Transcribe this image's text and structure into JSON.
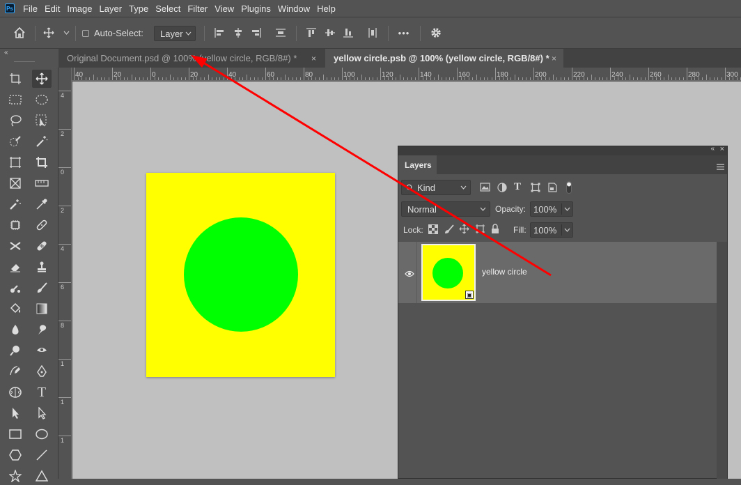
{
  "app": {
    "logo_text": "Ps"
  },
  "menu": [
    "File",
    "Edit",
    "Image",
    "Layer",
    "Type",
    "Select",
    "Filter",
    "View",
    "Plugins",
    "Window",
    "Help"
  ],
  "options": {
    "auto_select_label": "Auto-Select:",
    "layer_select_value": "Layer",
    "more_label": "•••"
  },
  "tabs": [
    {
      "label": "Original Document.psd @ 100% (yellow circle, RGB/8#) *",
      "close": "×"
    },
    {
      "label": "yellow circle.psb @ 100% (yellow circle, RGB/8#) *",
      "close": "×"
    }
  ],
  "ruler_top_labels": [
    "40",
    "20",
    "0",
    "20",
    "40",
    "60",
    "80",
    "100",
    "120",
    "140",
    "160",
    "180",
    "200",
    "220",
    "240",
    "260",
    "280",
    "300"
  ],
  "ruler_left_labels": [
    "4",
    "2",
    "0",
    "2",
    "4",
    "6",
    "8",
    "1",
    "1",
    "1"
  ],
  "layers_panel": {
    "tab_label": "Layers",
    "kind_label": "Kind",
    "blend_mode": "Normal",
    "opacity_label": "Opacity:",
    "opacity_value": "100%",
    "lock_label": "Lock:",
    "fill_label": "Fill:",
    "fill_value": "100%",
    "layer_name": "yellow circle"
  },
  "colors": {
    "document_fill": "#ffff00",
    "circle_fill": "#00ff00",
    "annotation_arrow": "#ff0000"
  }
}
